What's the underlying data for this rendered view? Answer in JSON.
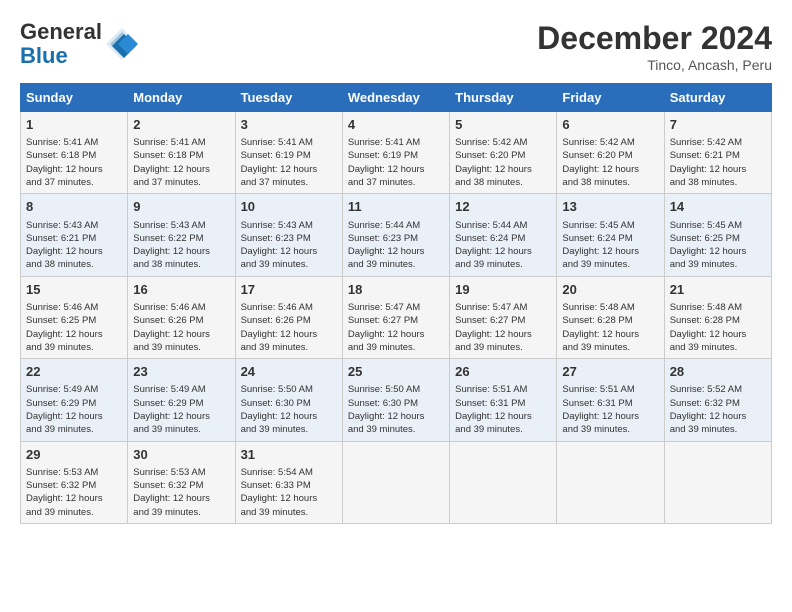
{
  "header": {
    "logo_line1": "General",
    "logo_line2": "Blue",
    "month_title": "December 2024",
    "location": "Tinco, Ancash, Peru"
  },
  "days_of_week": [
    "Sunday",
    "Monday",
    "Tuesday",
    "Wednesday",
    "Thursday",
    "Friday",
    "Saturday"
  ],
  "weeks": [
    [
      {
        "day": 1,
        "info": "Sunrise: 5:41 AM\nSunset: 6:18 PM\nDaylight: 12 hours\nand 37 minutes."
      },
      {
        "day": 2,
        "info": "Sunrise: 5:41 AM\nSunset: 6:18 PM\nDaylight: 12 hours\nand 37 minutes."
      },
      {
        "day": 3,
        "info": "Sunrise: 5:41 AM\nSunset: 6:19 PM\nDaylight: 12 hours\nand 37 minutes."
      },
      {
        "day": 4,
        "info": "Sunrise: 5:41 AM\nSunset: 6:19 PM\nDaylight: 12 hours\nand 37 minutes."
      },
      {
        "day": 5,
        "info": "Sunrise: 5:42 AM\nSunset: 6:20 PM\nDaylight: 12 hours\nand 38 minutes."
      },
      {
        "day": 6,
        "info": "Sunrise: 5:42 AM\nSunset: 6:20 PM\nDaylight: 12 hours\nand 38 minutes."
      },
      {
        "day": 7,
        "info": "Sunrise: 5:42 AM\nSunset: 6:21 PM\nDaylight: 12 hours\nand 38 minutes."
      }
    ],
    [
      {
        "day": 8,
        "info": "Sunrise: 5:43 AM\nSunset: 6:21 PM\nDaylight: 12 hours\nand 38 minutes."
      },
      {
        "day": 9,
        "info": "Sunrise: 5:43 AM\nSunset: 6:22 PM\nDaylight: 12 hours\nand 38 minutes."
      },
      {
        "day": 10,
        "info": "Sunrise: 5:43 AM\nSunset: 6:23 PM\nDaylight: 12 hours\nand 39 minutes."
      },
      {
        "day": 11,
        "info": "Sunrise: 5:44 AM\nSunset: 6:23 PM\nDaylight: 12 hours\nand 39 minutes."
      },
      {
        "day": 12,
        "info": "Sunrise: 5:44 AM\nSunset: 6:24 PM\nDaylight: 12 hours\nand 39 minutes."
      },
      {
        "day": 13,
        "info": "Sunrise: 5:45 AM\nSunset: 6:24 PM\nDaylight: 12 hours\nand 39 minutes."
      },
      {
        "day": 14,
        "info": "Sunrise: 5:45 AM\nSunset: 6:25 PM\nDaylight: 12 hours\nand 39 minutes."
      }
    ],
    [
      {
        "day": 15,
        "info": "Sunrise: 5:46 AM\nSunset: 6:25 PM\nDaylight: 12 hours\nand 39 minutes."
      },
      {
        "day": 16,
        "info": "Sunrise: 5:46 AM\nSunset: 6:26 PM\nDaylight: 12 hours\nand 39 minutes."
      },
      {
        "day": 17,
        "info": "Sunrise: 5:46 AM\nSunset: 6:26 PM\nDaylight: 12 hours\nand 39 minutes."
      },
      {
        "day": 18,
        "info": "Sunrise: 5:47 AM\nSunset: 6:27 PM\nDaylight: 12 hours\nand 39 minutes."
      },
      {
        "day": 19,
        "info": "Sunrise: 5:47 AM\nSunset: 6:27 PM\nDaylight: 12 hours\nand 39 minutes."
      },
      {
        "day": 20,
        "info": "Sunrise: 5:48 AM\nSunset: 6:28 PM\nDaylight: 12 hours\nand 39 minutes."
      },
      {
        "day": 21,
        "info": "Sunrise: 5:48 AM\nSunset: 6:28 PM\nDaylight: 12 hours\nand 39 minutes."
      }
    ],
    [
      {
        "day": 22,
        "info": "Sunrise: 5:49 AM\nSunset: 6:29 PM\nDaylight: 12 hours\nand 39 minutes."
      },
      {
        "day": 23,
        "info": "Sunrise: 5:49 AM\nSunset: 6:29 PM\nDaylight: 12 hours\nand 39 minutes."
      },
      {
        "day": 24,
        "info": "Sunrise: 5:50 AM\nSunset: 6:30 PM\nDaylight: 12 hours\nand 39 minutes."
      },
      {
        "day": 25,
        "info": "Sunrise: 5:50 AM\nSunset: 6:30 PM\nDaylight: 12 hours\nand 39 minutes."
      },
      {
        "day": 26,
        "info": "Sunrise: 5:51 AM\nSunset: 6:31 PM\nDaylight: 12 hours\nand 39 minutes."
      },
      {
        "day": 27,
        "info": "Sunrise: 5:51 AM\nSunset: 6:31 PM\nDaylight: 12 hours\nand 39 minutes."
      },
      {
        "day": 28,
        "info": "Sunrise: 5:52 AM\nSunset: 6:32 PM\nDaylight: 12 hours\nand 39 minutes."
      }
    ],
    [
      {
        "day": 29,
        "info": "Sunrise: 5:53 AM\nSunset: 6:32 PM\nDaylight: 12 hours\nand 39 minutes."
      },
      {
        "day": 30,
        "info": "Sunrise: 5:53 AM\nSunset: 6:32 PM\nDaylight: 12 hours\nand 39 minutes."
      },
      {
        "day": 31,
        "info": "Sunrise: 5:54 AM\nSunset: 6:33 PM\nDaylight: 12 hours\nand 39 minutes."
      },
      null,
      null,
      null,
      null
    ]
  ]
}
